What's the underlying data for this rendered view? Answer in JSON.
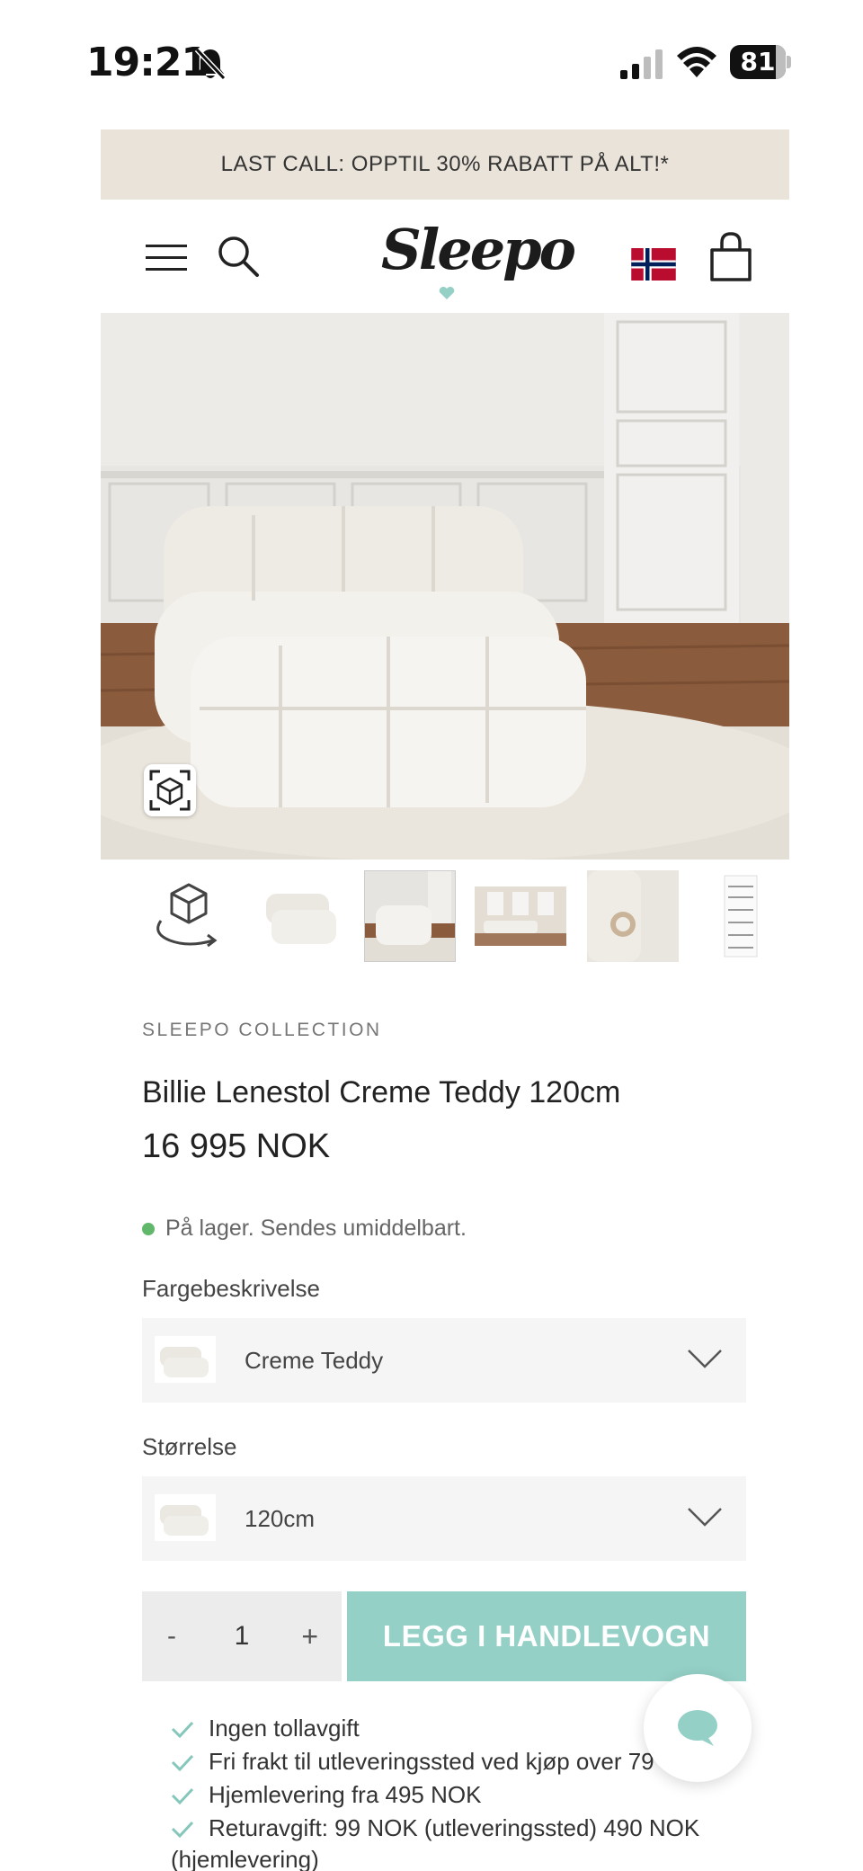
{
  "status_bar": {
    "time": "19:21",
    "battery": "81",
    "battery_level": 0.81
  },
  "promo": {
    "text": "LAST CALL: OPPTIL 30% RABATT PÅ ALT!*"
  },
  "header": {
    "logo": "Sleepo",
    "flag": "norway-flag-icon"
  },
  "hero": {
    "image": "teddy-lounge-chair-photo"
  },
  "thumbnails": [
    "3d-view-icon",
    "chair-cutout",
    "chair-in-room",
    "living-room-wide",
    "fabric-detail",
    "assembly-guide"
  ],
  "product": {
    "collection": "SLEEPO COLLECTION",
    "title": "Billie Lenestol Creme Teddy 120cm",
    "price": "16 995 NOK",
    "stock": "På lager. Sendes umiddelbart."
  },
  "options": {
    "color_label": "Fargebeskrivelse",
    "color_value": "Creme Teddy",
    "size_label": "Størrelse",
    "size_value": "120cm"
  },
  "cart": {
    "minus": "-",
    "quantity": "1",
    "plus": "+",
    "add_label": "LEGG I HANDLEVOGN"
  },
  "benefits": [
    "Ingen tollavgift",
    "Fri frakt til utleveringssted ved kjøp over 79",
    "Hjemlevering fra 495 NOK",
    "Returavgift: 99 NOK (utleveringssted) 490 NOK"
  ],
  "benefit_continuation": "(hjemlevering)",
  "colors": {
    "accent": "#94d0c6",
    "promo_bg": "#e9e3d9",
    "stock_dot": "#62b86a",
    "chat_icon": "#94d0c6"
  }
}
